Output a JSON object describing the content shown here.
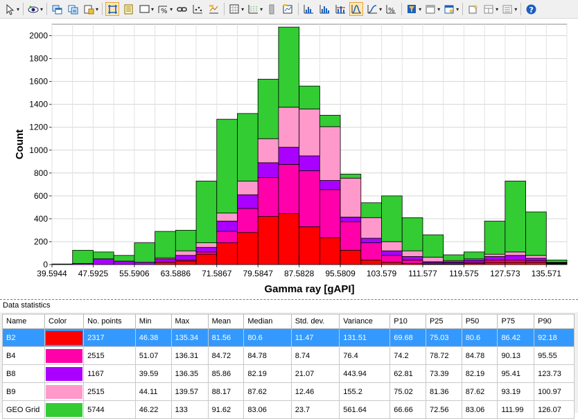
{
  "toolbar": {
    "buttons": [
      {
        "name": "select-pointer-icon",
        "dropdown": true,
        "active": false
      },
      {
        "name": "sep"
      },
      {
        "name": "view-eye-icon",
        "dropdown": true,
        "active": false
      },
      {
        "name": "sep"
      },
      {
        "name": "copy-window-icon",
        "dropdown": false,
        "active": false
      },
      {
        "name": "copy-data-icon",
        "dropdown": false,
        "active": false
      },
      {
        "name": "export-icon",
        "dropdown": true,
        "active": false
      },
      {
        "name": "sep"
      },
      {
        "name": "axes-frame-icon",
        "dropdown": false,
        "active": true
      },
      {
        "name": "table-list-icon",
        "dropdown": false,
        "active": false
      },
      {
        "name": "border-icon",
        "dropdown": true,
        "active": false
      },
      {
        "name": "percent-format-icon",
        "dropdown": true,
        "active": false
      },
      {
        "name": "link-icon",
        "dropdown": false,
        "active": false
      },
      {
        "name": "grid-points-icon",
        "dropdown": false,
        "active": false
      },
      {
        "name": "chart-settings-icon",
        "dropdown": false,
        "active": false
      },
      {
        "name": "sep"
      },
      {
        "name": "grid-lines-icon",
        "dropdown": true,
        "active": false
      },
      {
        "name": "grid-dots-icon",
        "dropdown": true,
        "active": false
      },
      {
        "name": "gray-bar-icon",
        "dropdown": false,
        "active": false
      },
      {
        "name": "chart-edit-icon",
        "dropdown": false,
        "active": false
      },
      {
        "name": "sep"
      },
      {
        "name": "histogram-icon",
        "dropdown": false,
        "active": false
      },
      {
        "name": "histogram-stacked-icon",
        "dropdown": false,
        "active": false
      },
      {
        "name": "histogram-lines-icon",
        "dropdown": false,
        "active": false
      },
      {
        "name": "distribution-curve-icon",
        "dropdown": false,
        "active": true
      },
      {
        "name": "cumulative-curve-icon",
        "dropdown": true,
        "active": false
      },
      {
        "name": "percent-icon",
        "dropdown": false,
        "active": false
      },
      {
        "name": "sep"
      },
      {
        "name": "filter-icon",
        "dropdown": true,
        "active": false
      },
      {
        "name": "window-icon",
        "dropdown": true,
        "active": false
      },
      {
        "name": "window-settings-icon",
        "dropdown": true,
        "active": false
      },
      {
        "name": "sep"
      },
      {
        "name": "new-sparkle-icon",
        "dropdown": false,
        "active": false
      },
      {
        "name": "layout-icon",
        "dropdown": true,
        "active": false
      },
      {
        "name": "list-settings-icon",
        "dropdown": true,
        "active": false
      },
      {
        "name": "sep"
      },
      {
        "name": "help-icon",
        "dropdown": false,
        "active": false
      }
    ]
  },
  "chart_data": {
    "type": "bar",
    "stacked": true,
    "xlabel": "Gamma ray [gAPI]",
    "ylabel": "Count",
    "ylim": [
      0,
      2100
    ],
    "yticks": [
      0,
      200,
      400,
      600,
      800,
      1000,
      1200,
      1400,
      1600,
      1800,
      2000
    ],
    "xlim": [
      39.5944,
      139.57
    ],
    "bin_start": 39.5944,
    "bin_width": 3.999,
    "xtick_labels": [
      "39.5944",
      "47.5925",
      "55.5906",
      "63.5886",
      "71.5867",
      "79.5847",
      "87.5828",
      "95.5809",
      "103.579",
      "111.577",
      "119.575",
      "127.573",
      "135.571"
    ],
    "grid": true,
    "series": [
      {
        "name": "B2",
        "color": "#ff0000",
        "values": [
          0,
          0,
          0,
          0,
          0,
          20,
          30,
          90,
          190,
          280,
          420,
          445,
          330,
          235,
          125,
          40,
          20,
          10,
          5,
          5,
          10,
          20,
          20,
          20,
          5
        ]
      },
      {
        "name": "B4",
        "color": "#ff00aa",
        "values": [
          0,
          0,
          0,
          0,
          0,
          0,
          10,
          20,
          100,
          210,
          340,
          430,
          490,
          420,
          250,
          150,
          60,
          30,
          10,
          10,
          10,
          20,
          20,
          15,
          5
        ]
      },
      {
        "name": "B8",
        "color": "#aa00ff",
        "values": [
          0,
          10,
          50,
          30,
          20,
          30,
          40,
          40,
          90,
          120,
          130,
          150,
          130,
          80,
          40,
          40,
          40,
          30,
          10,
          10,
          20,
          30,
          40,
          20,
          5
        ]
      },
      {
        "name": "B9",
        "color": "#ff99cc",
        "values": [
          0,
          0,
          0,
          0,
          0,
          10,
          40,
          40,
          70,
          120,
          210,
          350,
          410,
          470,
          340,
          180,
          80,
          50,
          40,
          10,
          10,
          20,
          30,
          25,
          5
        ]
      },
      {
        "name": "GEO Grid",
        "color": "#33cc33",
        "values": [
          5,
          115,
          60,
          50,
          170,
          230,
          180,
          540,
          820,
          590,
          520,
          700,
          200,
          100,
          35,
          130,
          400,
          290,
          195,
          50,
          60,
          290,
          620,
          380,
          20
        ]
      }
    ]
  },
  "stats": {
    "title": "Data statistics",
    "headers": [
      "Name",
      "Color",
      "No. points",
      "Min",
      "Max",
      "Mean",
      "Median",
      "Std. dev.",
      "Variance",
      "P10",
      "P25",
      "P50",
      "P75",
      "P90"
    ],
    "rows": [
      {
        "name": "B2",
        "color": "#ff0000",
        "points": "2317",
        "min": "46.38",
        "max": "135.34",
        "mean": "81.56",
        "median": "80.6",
        "std": "11.47",
        "variance": "131.51",
        "p10": "69.68",
        "p25": "75.03",
        "p50": "80.6",
        "p75": "86.42",
        "p90": "92.18",
        "selected": true
      },
      {
        "name": "B4",
        "color": "#ff00aa",
        "points": "2515",
        "min": "51.07",
        "max": "136.31",
        "mean": "84.72",
        "median": "84.78",
        "std": "8.74",
        "variance": "76.4",
        "p10": "74.2",
        "p25": "78.72",
        "p50": "84.78",
        "p75": "90.13",
        "p90": "95.55",
        "selected": false
      },
      {
        "name": "B8",
        "color": "#aa00ff",
        "points": "1167",
        "min": "39.59",
        "max": "136.35",
        "mean": "85.86",
        "median": "82.19",
        "std": "21.07",
        "variance": "443.94",
        "p10": "62.81",
        "p25": "73.39",
        "p50": "82.19",
        "p75": "95.41",
        "p90": "123.73",
        "selected": false
      },
      {
        "name": "B9",
        "color": "#ff99cc",
        "points": "2515",
        "min": "44.11",
        "max": "139.57",
        "mean": "88.17",
        "median": "87.62",
        "std": "12.46",
        "variance": "155.2",
        "p10": "75.02",
        "p25": "81.36",
        "p50": "87.62",
        "p75": "93.19",
        "p90": "100.97",
        "selected": false
      },
      {
        "name": "GEO Grid",
        "color": "#33cc33",
        "points": "5744",
        "min": "46.22",
        "max": "133",
        "mean": "91.62",
        "median": "83.06",
        "std": "23.7",
        "variance": "561.64",
        "p10": "66.66",
        "p25": "72.56",
        "p50": "83.06",
        "p75": "111.99",
        "p90": "126.07",
        "selected": false
      }
    ]
  }
}
